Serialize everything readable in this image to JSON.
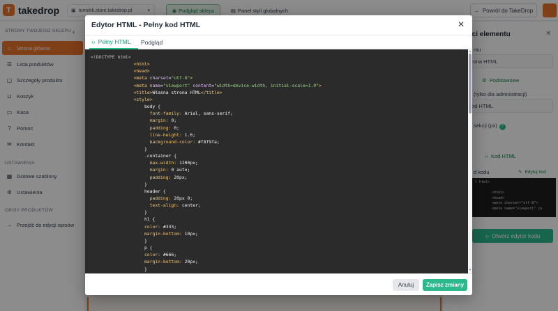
{
  "topbar": {
    "logo_badge": "T",
    "logo_text": "takedrop",
    "store_url": "tomekk.store.takedrop.pl",
    "preview_store": "Podgląd sklepu",
    "global_styles": "Panel styli globalnych",
    "back": "Powrót do TakeDrop"
  },
  "sidebar": {
    "section_store": "STRONY TWOJEGO SKLEPU",
    "section_settings": "USTAWIENIA",
    "section_products": "OPISY PRODUKTÓW",
    "items": [
      {
        "label": "Strona główna",
        "icon": "home-icon"
      },
      {
        "label": "Lista produktów",
        "icon": "list-icon"
      },
      {
        "label": "Szczegóły produktu",
        "icon": "product-icon"
      },
      {
        "label": "Koszyk",
        "icon": "cart-icon"
      },
      {
        "label": "Kasa",
        "icon": "checkout-icon"
      },
      {
        "label": "Pomoc",
        "icon": "help-icon"
      },
      {
        "label": "Kontakt",
        "icon": "contact-icon"
      }
    ],
    "settings_items": [
      {
        "label": "Gotowe szablony",
        "icon": "templates-icon"
      },
      {
        "label": "Ustawienia",
        "icon": "settings-icon"
      }
    ],
    "product_items": [
      {
        "label": "Przejdź do edycji opisów",
        "icon": "arrow-right-icon"
      }
    ]
  },
  "right_panel": {
    "title": "ości elementu",
    "label1": "ntu",
    "value1": "rona HTML",
    "basic": "Podstawowe",
    "label2": "(tylko dla administracji)",
    "value2": "od HTML",
    "label3": "sekcji (px)",
    "code_html": "Kod HTML",
    "label4": "d kodu",
    "edit_code": "Edytuj kod",
    "code_preview": "l html>\n\n        <html>\n        <head>\n        <meta charset=\"utf-8\">\n        <meta name=\"viewport\" co",
    "open_editor": "Otwórz edytor kodu"
  },
  "modal": {
    "title": "Edytor HTML - Pełny kod HTML",
    "tab_full": "Pełny HTML",
    "tab_preview": "Podgląd",
    "cancel": "Anuluj",
    "save": "Zapisz zmiany"
  },
  "code_lines": [
    [
      {
        "t": "<!DOCTYPE html>",
        "c": "c-doc"
      }
    ],
    [
      {
        "t": "                <html>",
        "c": "c-tag"
      }
    ],
    [
      {
        "t": "                <head>",
        "c": "c-tag"
      }
    ],
    [
      {
        "t": "                <meta ",
        "c": "c-tag"
      },
      {
        "t": "charset",
        "c": "c-attr"
      },
      {
        "t": "=",
        "c": "c-txt"
      },
      {
        "t": "\"utf-8\"",
        "c": "c-str"
      },
      {
        "t": ">",
        "c": "c-tag"
      }
    ],
    [
      {
        "t": "                <meta ",
        "c": "c-tag"
      },
      {
        "t": "name",
        "c": "c-attr"
      },
      {
        "t": "=",
        "c": "c-txt"
      },
      {
        "t": "\"viewport\" ",
        "c": "c-str"
      },
      {
        "t": "content",
        "c": "c-attr"
      },
      {
        "t": "=",
        "c": "c-txt"
      },
      {
        "t": "\"width=device-width, initial-scale=1.0\"",
        "c": "c-str"
      },
      {
        "t": ">",
        "c": "c-tag"
      }
    ],
    [
      {
        "t": "                <title>",
        "c": "c-tag"
      },
      {
        "t": "Własna strona HTML",
        "c": "c-txt"
      },
      {
        "t": "</title>",
        "c": "c-tag"
      }
    ],
    [
      {
        "t": "                <style>",
        "c": "c-tag"
      }
    ],
    [
      {
        "t": "                    body {",
        "c": "c-txt"
      }
    ],
    [
      {
        "t": "                      font-family: ",
        "c": "c-prop"
      },
      {
        "t": "Arial, sans-serif;",
        "c": "c-txt"
      }
    ],
    [
      {
        "t": "                      margin: ",
        "c": "c-prop"
      },
      {
        "t": "0;",
        "c": "c-txt"
      }
    ],
    [
      {
        "t": "                      padding: ",
        "c": "c-prop"
      },
      {
        "t": "0;",
        "c": "c-txt"
      }
    ],
    [
      {
        "t": "                      line-height: ",
        "c": "c-prop"
      },
      {
        "t": "1.6;",
        "c": "c-txt"
      }
    ],
    [
      {
        "t": "                      background-color: ",
        "c": "c-prop"
      },
      {
        "t": "#f8f9fa;",
        "c": "c-txt"
      }
    ],
    [
      {
        "t": "                    }",
        "c": "c-txt"
      }
    ],
    [
      {
        "t": "                    .container {",
        "c": "c-txt"
      }
    ],
    [
      {
        "t": "                      max-width: ",
        "c": "c-prop"
      },
      {
        "t": "1200px;",
        "c": "c-txt"
      }
    ],
    [
      {
        "t": "                      margin: ",
        "c": "c-prop"
      },
      {
        "t": "0 auto;",
        "c": "c-txt"
      }
    ],
    [
      {
        "t": "                      padding: ",
        "c": "c-prop"
      },
      {
        "t": "20px;",
        "c": "c-txt"
      }
    ],
    [
      {
        "t": "                    }",
        "c": "c-txt"
      }
    ],
    [
      {
        "t": "                    header {",
        "c": "c-txt"
      }
    ],
    [
      {
        "t": "                      padding: ",
        "c": "c-prop"
      },
      {
        "t": "20px 0;",
        "c": "c-txt"
      }
    ],
    [
      {
        "t": "                      text-align: ",
        "c": "c-prop"
      },
      {
        "t": "center;",
        "c": "c-txt"
      }
    ],
    [
      {
        "t": "                    }",
        "c": "c-txt"
      }
    ],
    [
      {
        "t": "                    h1 {",
        "c": "c-txt"
      }
    ],
    [
      {
        "t": "                    color: ",
        "c": "c-prop"
      },
      {
        "t": "#333;",
        "c": "c-txt"
      }
    ],
    [
      {
        "t": "                    margin-bottom: ",
        "c": "c-prop"
      },
      {
        "t": "10px;",
        "c": "c-txt"
      }
    ],
    [
      {
        "t": "                    }",
        "c": "c-txt"
      }
    ],
    [
      {
        "t": "                    p {",
        "c": "c-txt"
      }
    ],
    [
      {
        "t": "                    color: ",
        "c": "c-prop"
      },
      {
        "t": "#666;",
        "c": "c-txt"
      }
    ],
    [
      {
        "t": "                    margin-bottom: ",
        "c": "c-prop"
      },
      {
        "t": "20px;",
        "c": "c-txt"
      }
    ],
    [
      {
        "t": "                    }",
        "c": "c-txt"
      }
    ]
  ],
  "colors": {
    "brand_orange": "#e8742a",
    "accent_green": "#2bb88a",
    "editor_bg": "#2b2b2b"
  }
}
